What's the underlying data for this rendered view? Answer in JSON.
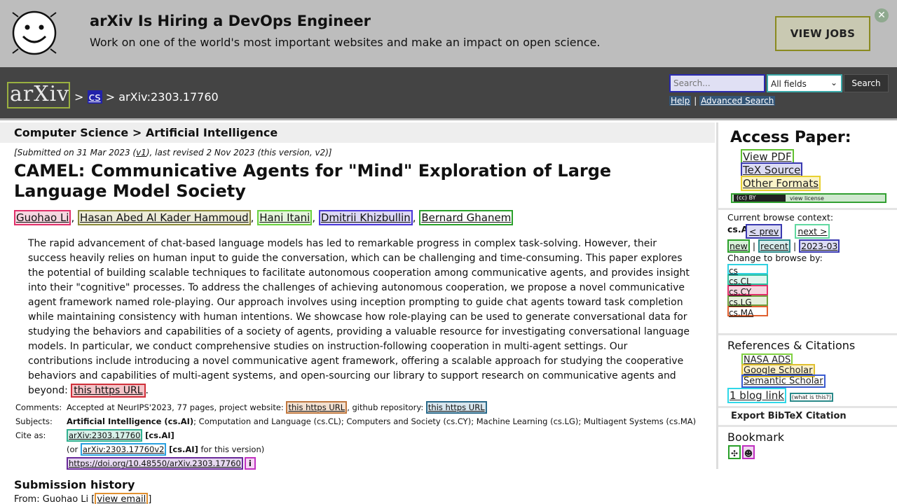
{
  "banner": {
    "title": "arXiv Is Hiring a DevOps Engineer",
    "text": "Work on one of the world's most important websites and make an impact on open science.",
    "button": "VIEW JOBS",
    "close_glyph": "✕"
  },
  "header": {
    "logo": "arXiv",
    "crumb_sep1": ">",
    "crumb_cs": "cs",
    "crumb_sep2": ">",
    "crumb_id": "arXiv:2303.17760",
    "search_placeholder": "Search...",
    "field_select": "All fields",
    "search_button": "Search",
    "help": "Help",
    "link_sep": "|",
    "advanced": "Advanced Search"
  },
  "main": {
    "subject": "Computer Science > Artificial Intelligence",
    "date_prefix": "[Submitted on 31 Mar 2023 (",
    "date_v1": "v1",
    "date_suffix": "), last revised 2 Nov 2023 (this version, v2)]",
    "title": "CAMEL: Communicative Agents for \"Mind\" Exploration of Large Language Model Society",
    "authors": [
      "Guohao Li",
      "Hasan Abed Al Kader Hammoud",
      "Hani Itani",
      "Dmitrii Khizbullin",
      "Bernard Ghanem"
    ],
    "author_sep": ",",
    "abstract": "The rapid advancement of chat-based language models has led to remarkable progress in complex task-solving. However, their success heavily relies on human input to guide the conversation, which can be challenging and time-consuming. This paper explores the potential of building scalable techniques to facilitate autonomous cooperation among communicative agents, and provides insight into their \"cognitive\" processes. To address the challenges of achieving autonomous cooperation, we propose a novel communicative agent framework named role-playing. Our approach involves using inception prompting to guide chat agents toward task completion while maintaining consistency with human intentions. We showcase how role-playing can be used to generate conversational data for studying the behaviors and capabilities of a society of agents, providing a valuable resource for investigating conversational language models. In particular, we conduct comprehensive studies on instruction-following cooperation in multi-agent settings. Our contributions include introducing a novel communicative agent framework, offering a scalable approach for studying the cooperative behaviors and capabilities of multi-agent systems, and open-sourcing our library to support research on communicative agents and beyond:",
    "abstract_link": "this https URL",
    "abstract_end": ".",
    "comments_label": "Comments:",
    "comments_pre": "Accepted at NeurIPS'2023, 77 pages, project website:",
    "comments_link1": "this https URL",
    "comments_mid": ", github repository:",
    "comments_link2": "this https URL",
    "subjects_label": "Subjects:",
    "subjects_primary": "Artificial Intelligence (cs.AI)",
    "subjects_rest": "; Computation and Language (cs.CL); Computers and Society (cs.CY); Machine Learning (cs.LG); Multiagent Systems (cs.MA)",
    "cite_label": "Cite as:",
    "cite_id": "arXiv:2303.17760",
    "cite_tag": "[cs.AI]",
    "cite_or": "(or",
    "cite_v2": "arXiv:2303.17760v2",
    "cite_v2_tag": "[cs.AI]",
    "cite_or_end": "for this version)",
    "doi": "https://doi.org/10.48550/arXiv.2303.17760",
    "doi_info": "i",
    "history_title": "Submission history",
    "history_from": "From: Guohao Li [",
    "history_email": "view email",
    "history_end": "]"
  },
  "sidebar": {
    "access_title": "Access Paper:",
    "access_links": [
      "View PDF",
      "TeX Source",
      "Other Formats"
    ],
    "license_badge": "(cc) BY",
    "license_link": "view license",
    "browse_context_label": "Current browse context:",
    "browse_context": "cs.AI",
    "prev": "< prev",
    "next": "next >",
    "new": "new",
    "recent": "recent",
    "month": "2023-03",
    "change_browse": "Change to browse by:",
    "browse_cats": [
      "cs",
      "cs.CL",
      "cs.CY",
      "cs.LG",
      "cs.MA"
    ],
    "refs_title": "References & Citations",
    "refs": [
      "NASA ADS",
      "Google Scholar",
      "Semantic Scholar"
    ],
    "blog": "1 blog link",
    "blog_what": "(what is this?)",
    "bibtex": "Export BibTeX Citation",
    "bookmark_title": "Bookmark"
  }
}
